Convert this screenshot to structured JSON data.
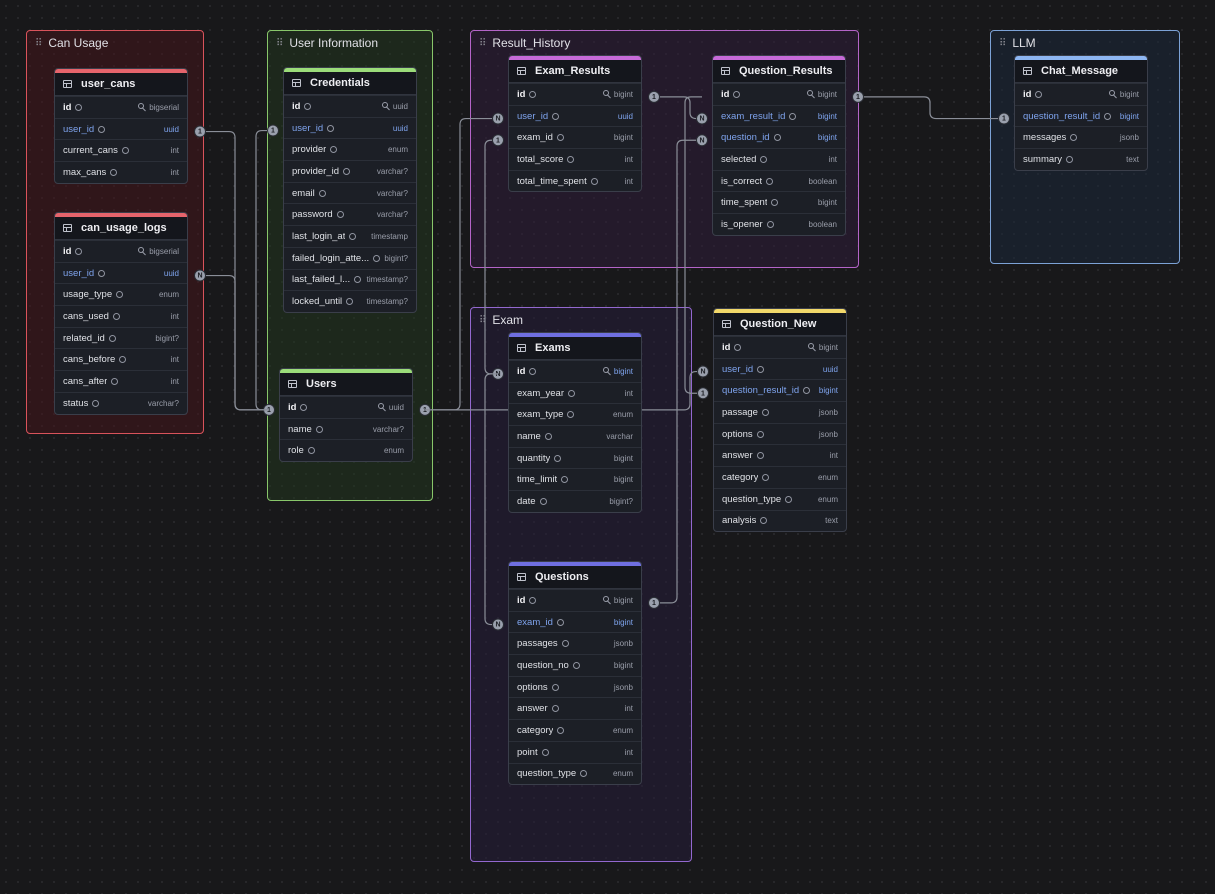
{
  "groups": [
    {
      "id": "g-can",
      "title": "Can Usage"
    },
    {
      "id": "g-user",
      "title": "User Information"
    },
    {
      "id": "g-result",
      "title": "Result_History"
    },
    {
      "id": "g-llm",
      "title": "LLM"
    },
    {
      "id": "g-exam",
      "title": "Exam"
    }
  ],
  "colors": {
    "can": "#e5646c",
    "user": "#9bdc7a",
    "result": "#c66ad8",
    "llm": "#8db6f2",
    "exam": "#6f6fe0",
    "question_new": "#f1d86a",
    "fk_text": "#7fa4ee"
  },
  "tables": [
    {
      "id": "user_cans",
      "name": "user_cans",
      "color": "#e5646c",
      "fields": [
        {
          "name": "id",
          "type": "bigserial",
          "pk": true
        },
        {
          "name": "user_id",
          "type": "uuid",
          "fk": true
        },
        {
          "name": "current_cans",
          "type": "int"
        },
        {
          "name": "max_cans",
          "type": "int"
        }
      ]
    },
    {
      "id": "can_usage_logs",
      "name": "can_usage_logs",
      "color": "#e5646c",
      "fields": [
        {
          "name": "id",
          "type": "bigserial",
          "pk": true
        },
        {
          "name": "user_id",
          "type": "uuid",
          "fk": true
        },
        {
          "name": "usage_type",
          "type": "enum"
        },
        {
          "name": "cans_used",
          "type": "int"
        },
        {
          "name": "related_id",
          "type": "bigint?"
        },
        {
          "name": "cans_before",
          "type": "int"
        },
        {
          "name": "cans_after",
          "type": "int"
        },
        {
          "name": "status",
          "type": "varchar?"
        }
      ]
    },
    {
      "id": "credentials",
      "name": "Credentials",
      "color": "#9bdc7a",
      "fields": [
        {
          "name": "id",
          "type": "uuid",
          "pk": true
        },
        {
          "name": "user_id",
          "type": "uuid",
          "fk": true
        },
        {
          "name": "provider",
          "type": "enum"
        },
        {
          "name": "provider_id",
          "type": "varchar?"
        },
        {
          "name": "email",
          "type": "varchar?"
        },
        {
          "name": "password",
          "type": "varchar?"
        },
        {
          "name": "last_login_at",
          "type": "timestamp"
        },
        {
          "name": "failed_login_atte...",
          "type": "bigint?"
        },
        {
          "name": "last_failed_l...",
          "type": "timestamp?"
        },
        {
          "name": "locked_until",
          "type": "timestamp?"
        }
      ]
    },
    {
      "id": "users",
      "name": "Users",
      "color": "#9bdc7a",
      "fields": [
        {
          "name": "id",
          "type": "uuid",
          "pk": true
        },
        {
          "name": "name",
          "type": "varchar?"
        },
        {
          "name": "role",
          "type": "enum"
        }
      ]
    },
    {
      "id": "exam_results",
      "name": "Exam_Results",
      "color": "#c66ad8",
      "fields": [
        {
          "name": "id",
          "type": "bigint",
          "pk": true
        },
        {
          "name": "user_id",
          "type": "uuid",
          "fk": true
        },
        {
          "name": "exam_id",
          "type": "bigint"
        },
        {
          "name": "total_score",
          "type": "int"
        },
        {
          "name": "total_time_spent",
          "type": "int"
        }
      ]
    },
    {
      "id": "question_results",
      "name": "Question_Results",
      "color": "#c66ad8",
      "fields": [
        {
          "name": "id",
          "type": "bigint",
          "pk": true
        },
        {
          "name": "exam_result_id",
          "type": "bigint",
          "fk": true
        },
        {
          "name": "question_id",
          "type": "bigint",
          "fk": true
        },
        {
          "name": "selected",
          "type": "int"
        },
        {
          "name": "is_correct",
          "type": "boolean"
        },
        {
          "name": "time_spent",
          "type": "bigint"
        },
        {
          "name": "is_opener",
          "type": "boolean"
        }
      ]
    },
    {
      "id": "chat_message",
      "name": "Chat_Message",
      "color": "#8db6f2",
      "fields": [
        {
          "name": "id",
          "type": "bigint",
          "pk": true
        },
        {
          "name": "question_result_id",
          "type": "bigint",
          "fk": true
        },
        {
          "name": "messages",
          "type": "jsonb"
        },
        {
          "name": "summary",
          "type": "text"
        }
      ]
    },
    {
      "id": "exams",
      "name": "Exams",
      "color": "#6f6fe0",
      "fields": [
        {
          "name": "id",
          "type": "bigint",
          "pk": true,
          "fk": true
        },
        {
          "name": "exam_year",
          "type": "int"
        },
        {
          "name": "exam_type",
          "type": "enum"
        },
        {
          "name": "name",
          "type": "varchar"
        },
        {
          "name": "quantity",
          "type": "bigint"
        },
        {
          "name": "time_limit",
          "type": "bigint"
        },
        {
          "name": "date",
          "type": "bigint?"
        }
      ]
    },
    {
      "id": "question_new",
      "name": "Question_New",
      "color": "#f1d86a",
      "fields": [
        {
          "name": "id",
          "type": "bigint",
          "pk": true
        },
        {
          "name": "user_id",
          "type": "uuid",
          "fk": true
        },
        {
          "name": "question_result_id",
          "type": "bigint",
          "fk": true
        },
        {
          "name": "passage",
          "type": "jsonb"
        },
        {
          "name": "options",
          "type": "jsonb"
        },
        {
          "name": "answer",
          "type": "int"
        },
        {
          "name": "category",
          "type": "enum"
        },
        {
          "name": "question_type",
          "type": "enum"
        },
        {
          "name": "analysis",
          "type": "text"
        }
      ]
    },
    {
      "id": "questions",
      "name": "Questions",
      "color": "#6f6fe0",
      "fields": [
        {
          "name": "id",
          "type": "bigint",
          "pk": true
        },
        {
          "name": "exam_id",
          "type": "bigint",
          "fk": true
        },
        {
          "name": "passages",
          "type": "jsonb"
        },
        {
          "name": "question_no",
          "type": "bigint"
        },
        {
          "name": "options",
          "type": "jsonb"
        },
        {
          "name": "answer",
          "type": "int"
        },
        {
          "name": "category",
          "type": "enum"
        },
        {
          "name": "point",
          "type": "int"
        },
        {
          "name": "question_type",
          "type": "enum"
        }
      ]
    }
  ],
  "relations": [
    {
      "from": "users.id",
      "to": "user_cans.user_id",
      "from_card": "1",
      "to_card": "1"
    },
    {
      "from": "users.id",
      "to": "can_usage_logs.user_id",
      "from_card": "1",
      "to_card": "N"
    },
    {
      "from": "users.id",
      "to": "credentials.user_id",
      "from_card": "1",
      "to_card": "1"
    },
    {
      "from": "users.id",
      "to": "exam_results.user_id",
      "from_card": "1",
      "to_card": "N"
    },
    {
      "from": "users.id",
      "to": "question_new.user_id",
      "from_card": "1",
      "to_card": "N"
    },
    {
      "from": "exams.id",
      "to": "exam_results.exam_id",
      "from_card": "N",
      "to_card": "1"
    },
    {
      "from": "exams.id",
      "to": "questions.exam_id",
      "from_card": "N",
      "to_card": "N"
    },
    {
      "from": "exam_results.id",
      "to": "question_results.exam_result_id",
      "from_card": "1",
      "to_card": "N"
    },
    {
      "from": "questions.id",
      "to": "question_results.question_id",
      "from_card": "1",
      "to_card": "N"
    },
    {
      "from": "question_results.id",
      "to": "chat_message.question_result_id",
      "from_card": "1",
      "to_card": "1"
    },
    {
      "from": "question_results.id",
      "to": "question_new.question_result_id",
      "from_card": "1",
      "to_card": "1"
    }
  ]
}
